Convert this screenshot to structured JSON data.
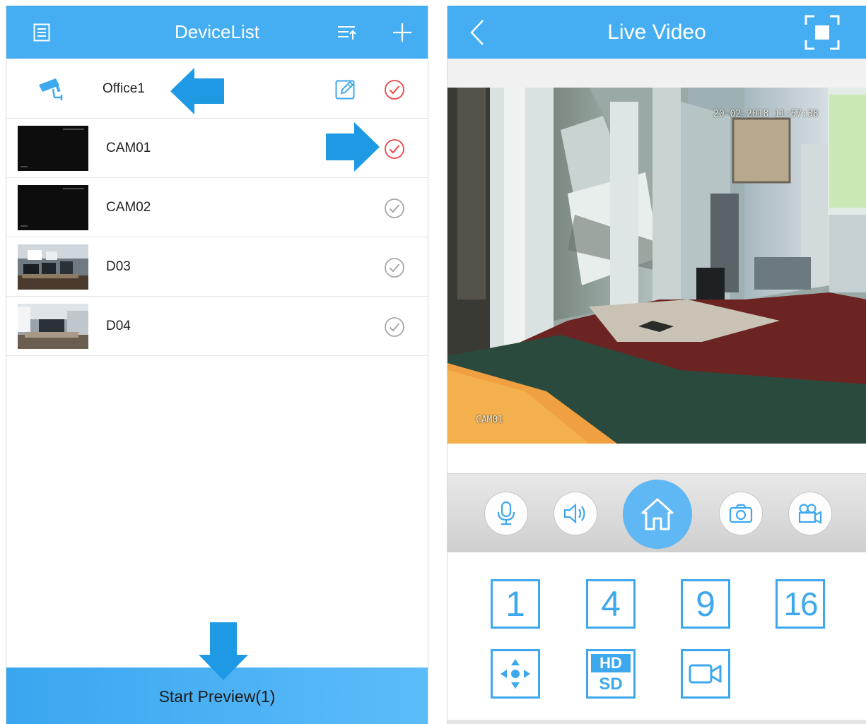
{
  "left_screen": {
    "header": {
      "title": "DeviceList",
      "icons": [
        "list-icon",
        "sort-icon",
        "add-icon"
      ]
    },
    "group": {
      "label": "Office1",
      "icons": [
        "cctv-camera-icon",
        "edit-icon",
        "check-circle-icon"
      ],
      "selected": true
    },
    "devices": [
      {
        "label": "CAM01",
        "selected": true
      },
      {
        "label": "CAM02",
        "selected": false
      },
      {
        "label": "D03",
        "selected": false
      },
      {
        "label": "D04",
        "selected": false
      }
    ],
    "start_button_label": "Start Preview(1)"
  },
  "right_screen": {
    "header": {
      "title": "Live Video",
      "icons": [
        "back-icon",
        "fullscreen-icon"
      ]
    },
    "video": {
      "timestamp": "20-02-2018 11:57:38",
      "camera_label": "CAM01"
    },
    "controls": [
      "microphone-icon",
      "speaker-icon",
      "home-icon",
      "camera-icon",
      "video-record-icon"
    ],
    "layout_buttons": [
      "1",
      "4",
      "9",
      "16"
    ],
    "extra_buttons": [
      "ptz-icon",
      "hd-sd-icon",
      "playback-icon"
    ],
    "hd_label": "HD",
    "sd_label": "SD"
  },
  "colors": {
    "header_blue": "#45aef3",
    "accent_blue": "#3ea8ee",
    "selected_red": "#e8474a",
    "unselected_gray": "#a8a8a8"
  }
}
